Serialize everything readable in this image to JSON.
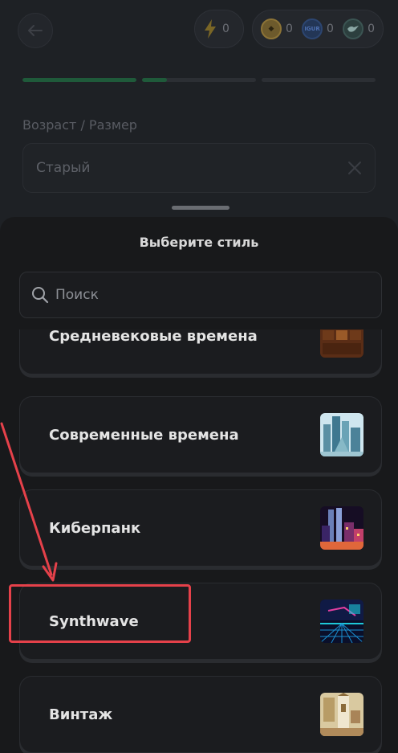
{
  "header": {
    "energy_count": "0",
    "tokens": [
      {
        "icon": "coin-gold-icon",
        "count": "0"
      },
      {
        "icon": "igur-coin-icon",
        "badge": "IGUR",
        "count": "0"
      },
      {
        "icon": "bird-coin-icon",
        "count": "0"
      }
    ]
  },
  "progress": [
    1.0,
    0.2,
    0.0
  ],
  "form": {
    "label": "Возраст / Размер",
    "value": "Старый"
  },
  "sheet": {
    "title": "Выберите стиль",
    "search_placeholder": "Поиск",
    "styles": [
      {
        "label": "Средневековые времена",
        "thumb": "medieval-thumbnail"
      },
      {
        "label": "Современные времена",
        "thumb": "modern-city-thumbnail"
      },
      {
        "label": "Киберпанк",
        "thumb": "cyberpunk-thumbnail"
      },
      {
        "label": "Synthwave",
        "thumb": "synthwave-thumbnail"
      },
      {
        "label": "Винтаж",
        "thumb": "vintage-thumbnail"
      }
    ]
  },
  "colors": {
    "accent": "#1f5a3a",
    "highlight": "#e5414a",
    "sheet_bg": "#18191b"
  }
}
